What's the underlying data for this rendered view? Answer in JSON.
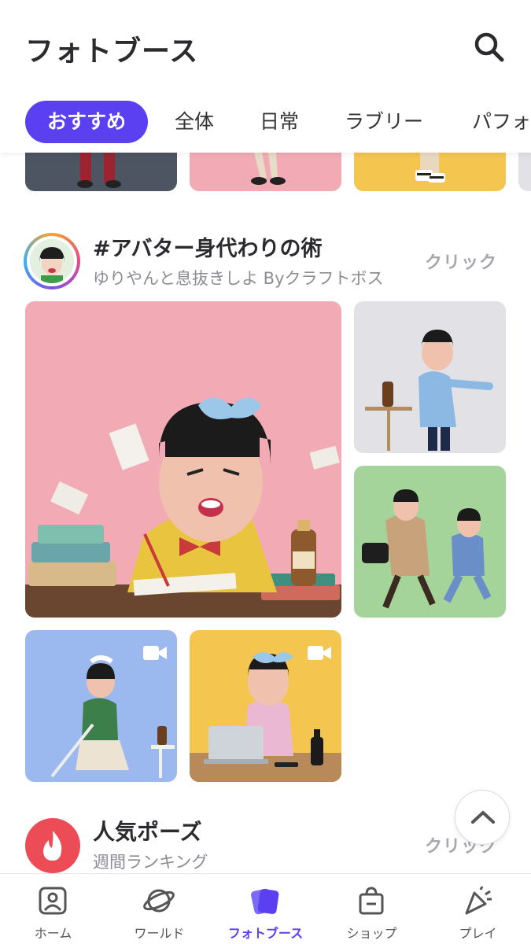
{
  "header": {
    "title": "フォトブース",
    "search_icon": "search-icon"
  },
  "tabs": [
    {
      "label": "おすすめ",
      "active": true
    },
    {
      "label": "全体"
    },
    {
      "label": "日常"
    },
    {
      "label": "ラブリー"
    },
    {
      "label": "パフォ"
    }
  ],
  "section1": {
    "title": "#アバター身代わりの術",
    "subtitle": "ゆりやんと息抜きしよ Byクラフトボス",
    "click_label": "クリック"
  },
  "section2": {
    "title": "人気ポーズ",
    "subtitle": "週間ランキング",
    "click_label": "クリック",
    "icon": "flame-icon"
  },
  "bottom_nav": [
    {
      "label": "ホーム",
      "icon": "home-icon"
    },
    {
      "label": "ワールド",
      "icon": "planet-icon"
    },
    {
      "label": "フォトブース",
      "icon": "photobooth-icon",
      "active": true
    },
    {
      "label": "ショップ",
      "icon": "shopping-bag-icon"
    },
    {
      "label": "プレイ",
      "icon": "party-popper-icon"
    }
  ],
  "colors": {
    "accent": "#5a40f0",
    "card_pink": "#f2abb5",
    "card_gray": "#e1e1e6",
    "card_green": "#a4d49a",
    "card_blue": "#9bb9ee",
    "card_yellow": "#f4c64f",
    "card_slate": "#4d5462",
    "flame_red": "#ec4c55"
  }
}
